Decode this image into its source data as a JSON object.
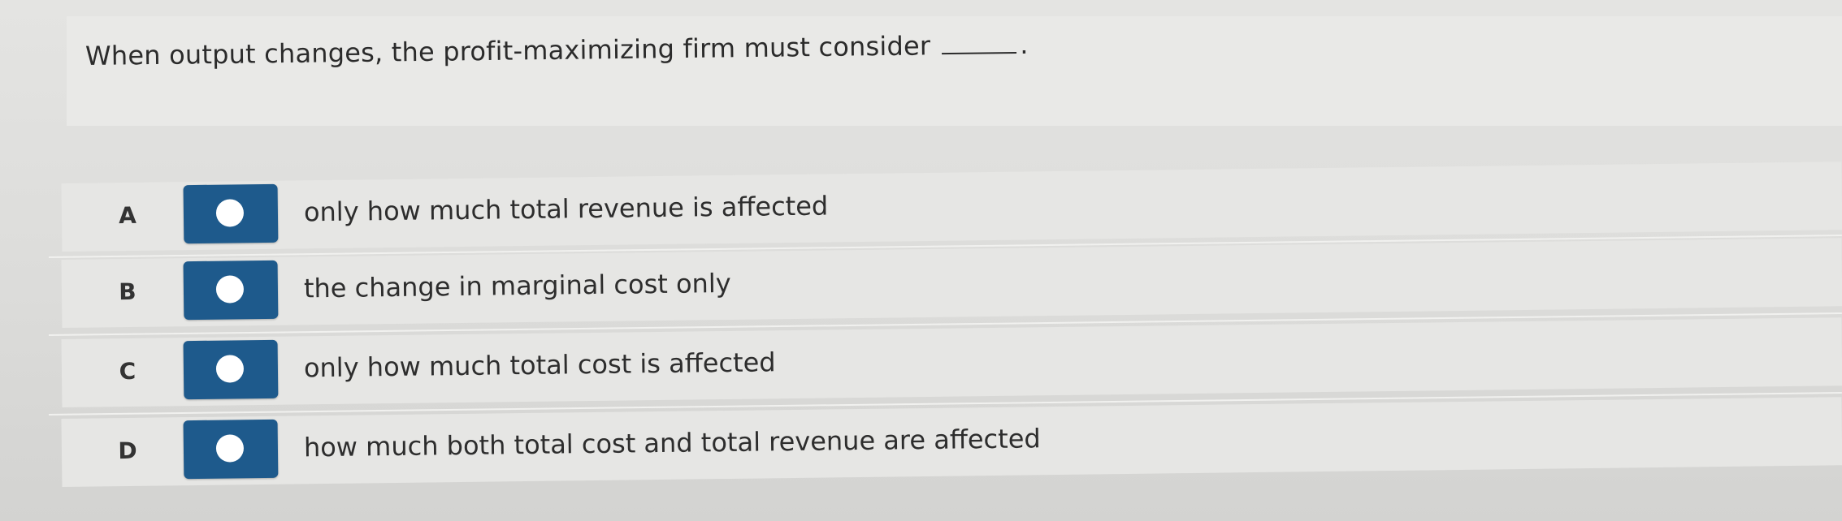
{
  "question": {
    "text": "When output changes, the profit-maximizing firm must consider",
    "end_punctuation": "."
  },
  "options": [
    {
      "letter": "A",
      "text": "only how much total revenue is affected",
      "selected": false
    },
    {
      "letter": "B",
      "text": "the change in marginal cost only",
      "selected": false
    },
    {
      "letter": "C",
      "text": "only how much total cost is affected",
      "selected": false
    },
    {
      "letter": "D",
      "text": "how much both total cost and total revenue are affected",
      "selected": false
    }
  ],
  "colors": {
    "radio_button": "#1e5a8c",
    "radio_dot": "#ffffff",
    "text": "#2b2b2b",
    "background": "#dcdcda"
  },
  "icons": {
    "radio": "radio-button-icon"
  }
}
